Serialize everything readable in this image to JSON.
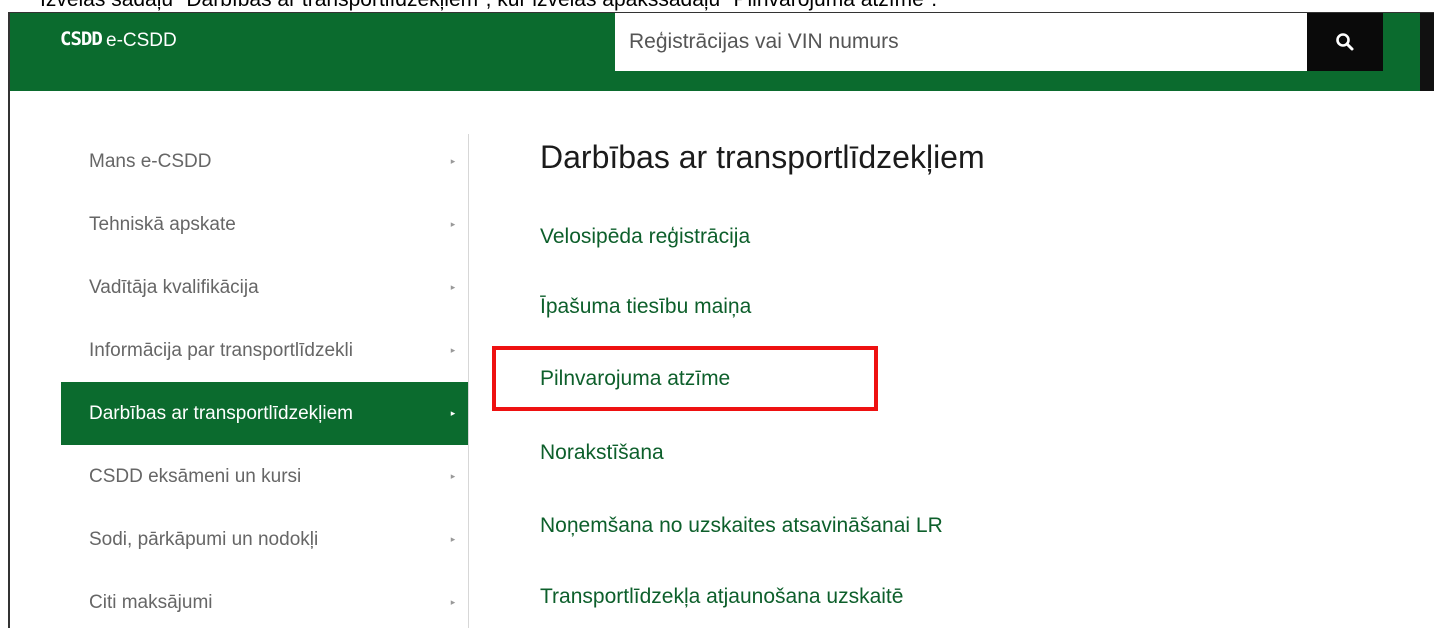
{
  "caption": "Izvēlas sadaļu \"Darbības ar transportlīdzekļiem\", kur izvēlas apakšsadaļu \"Pilnvarojuma atzīme\".",
  "header": {
    "logo": "CSDD",
    "brand": "e-CSDD",
    "search_placeholder": "Reģistrācijas vai VIN numurs",
    "search_icon": "search-icon"
  },
  "sidebar": {
    "items": [
      {
        "label": "Mans e-CSDD",
        "active": false
      },
      {
        "label": "Tehniskā apskate",
        "active": false
      },
      {
        "label": "Vadītāja kvalifikācija",
        "active": false
      },
      {
        "label": "Informācija par transportlīdzekli",
        "active": false
      },
      {
        "label": "Darbības ar transportlīdzekļiem",
        "active": true
      },
      {
        "label": "CSDD eksāmeni un kursi",
        "active": false
      },
      {
        "label": "Sodi, pārkāpumi un nodokļi",
        "active": false
      },
      {
        "label": "Citi maksājumi",
        "active": false
      }
    ],
    "arrow_icon": "caret-right-icon"
  },
  "main": {
    "title": "Darbības ar transportlīdzekļiem",
    "links": [
      {
        "label": "Velosipēda reģistrācija"
      },
      {
        "label": "Īpašuma tiesību maiņa"
      },
      {
        "label": "Pilnvarojuma atzīme",
        "highlighted": true
      },
      {
        "label": "Norakstīšana"
      },
      {
        "label": "Noņemšana no uzskaites atsavināšanai LR"
      },
      {
        "label": "Transportlīdzekļa atjaunošana uzskaitē"
      }
    ]
  },
  "colors": {
    "brand_green": "#0b6b2e",
    "link_green": "#0d5f2b",
    "highlight_red": "#ee1111"
  }
}
